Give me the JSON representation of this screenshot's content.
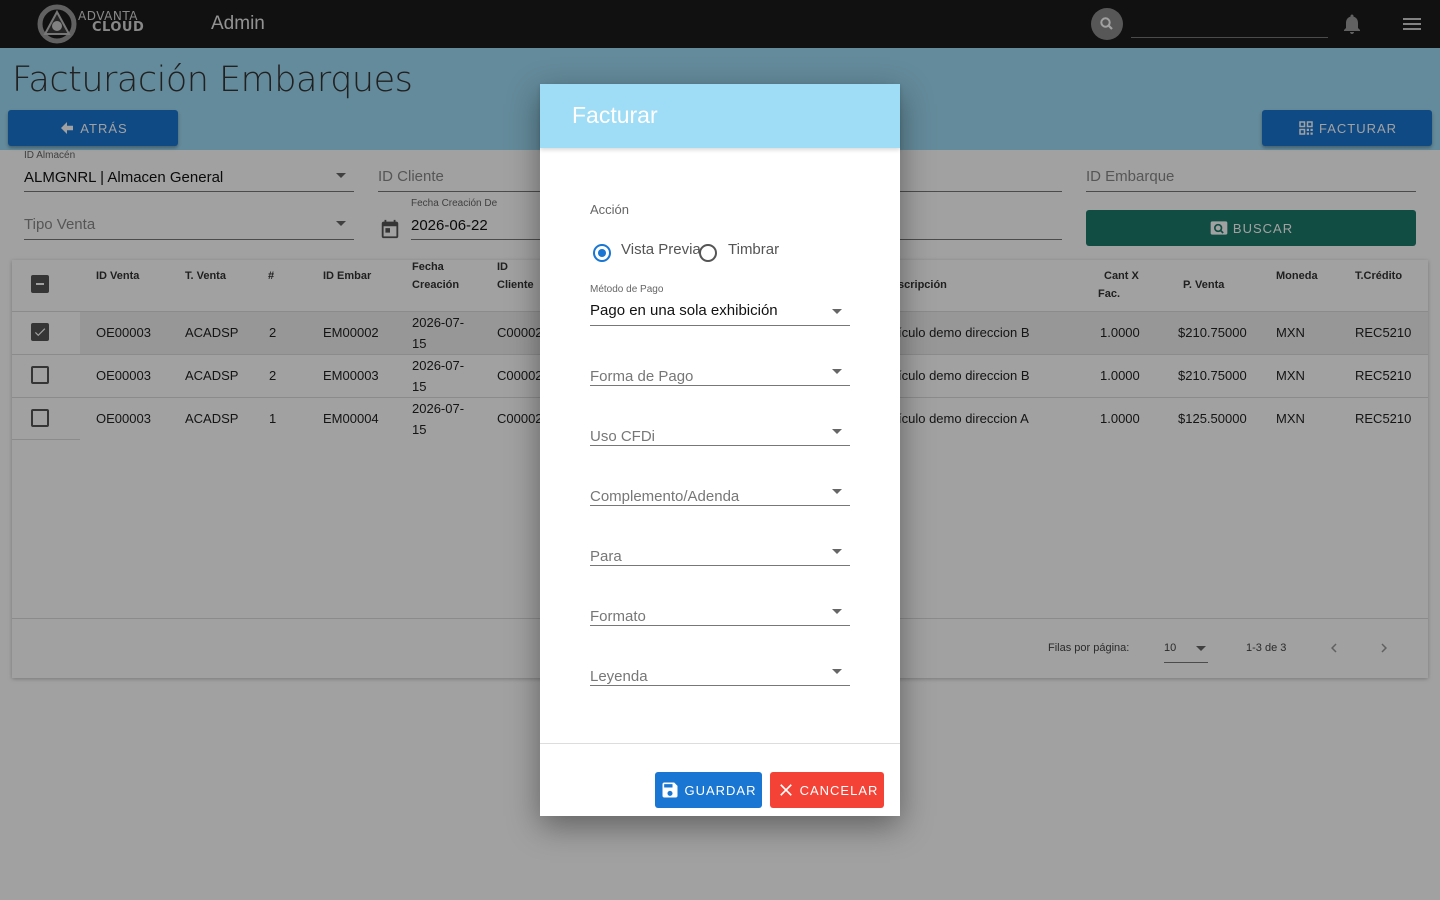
{
  "header": {
    "logo_line1": "ADVANTA",
    "logo_line2": "CLOUD",
    "app_title": "Admin",
    "icons": [
      "search-icon",
      "bell-icon",
      "menu-icon"
    ]
  },
  "page": {
    "title": "Facturación Embarques",
    "back_label": "ATRÁS",
    "facturar_label": "FACTURAR",
    "buscar_label": "BUSCAR"
  },
  "filters": {
    "almacen_label": "ID Almacén",
    "almacen_value": "ALMGNRL | Almacen General",
    "cliente_placeholder": "ID Cliente",
    "embarque_placeholder": "ID Embarque",
    "tipo_venta_placeholder": "Tipo Venta",
    "fecha_label": "Fecha Creación De",
    "fecha_value": "2026-06-22"
  },
  "table": {
    "headers": {
      "id_venta": "ID Venta",
      "t_venta": "T. Venta",
      "num": "#",
      "id_embar": "ID Embar",
      "fecha_1": "Fecha",
      "fecha_2": "Creación",
      "id_cli_1": "ID",
      "id_cli_2": "Cliente",
      "descripcion": "scripción",
      "cant_1": "Cant X",
      "cant_2": "Fac.",
      "p_venta": "P. Venta",
      "moneda": "Moneda",
      "t_credito": "T.Crédito"
    },
    "rows": [
      {
        "checked": true,
        "id_venta": "OE00003",
        "t_venta": "ACADSP",
        "num": "2",
        "id_embar": "EM00002",
        "fecha_1": "2026-07-",
        "fecha_2": "15",
        "cliente": "C00002",
        "descripcion": "ículo demo direccion B",
        "cant": "1.0000",
        "p_venta": "$210.75000",
        "moneda": "MXN",
        "t_credito": "REC5210"
      },
      {
        "checked": false,
        "id_venta": "OE00003",
        "t_venta": "ACADSP",
        "num": "2",
        "id_embar": "EM00003",
        "fecha_1": "2026-07-",
        "fecha_2": "15",
        "cliente": "C00002",
        "descripcion": "ículo demo direccion B",
        "cant": "1.0000",
        "p_venta": "$210.75000",
        "moneda": "MXN",
        "t_credito": "REC5210"
      },
      {
        "checked": false,
        "id_venta": "OE00003",
        "t_venta": "ACADSP",
        "num": "1",
        "id_embar": "EM00004",
        "fecha_1": "2026-07-",
        "fecha_2": "15",
        "cliente": "C00002",
        "descripcion": "ículo demo direccion A",
        "cant": "1.0000",
        "p_venta": "$125.50000",
        "moneda": "MXN",
        "t_credito": "REC5210"
      }
    ],
    "footer": {
      "rows_per_page_label": "Filas por página:",
      "rows_per_page_value": "10",
      "range": "1-3 de 3"
    }
  },
  "dialog": {
    "title": "Facturar",
    "accion_label": "Acción",
    "radio_vista": "Vista Previa",
    "radio_timbrar": "Timbrar",
    "selected_radio": "Vista Previa",
    "metodo_label": "Método de Pago",
    "metodo_value": "Pago en una sola exhibición",
    "forma_pago": "Forma de Pago",
    "uso_cfdi": "Uso CFDi",
    "complemento": "Complemento/Adenda",
    "para": "Para",
    "formato": "Formato",
    "leyenda": "Leyenda",
    "guardar_label": "GUARDAR",
    "cancelar_label": "CANCELAR"
  },
  "colors": {
    "topbar": "#1c1c1c",
    "band": "#9fdcf5",
    "primary": "#1976d2",
    "buscar": "#1d7a6c",
    "cancel": "#f44336"
  }
}
